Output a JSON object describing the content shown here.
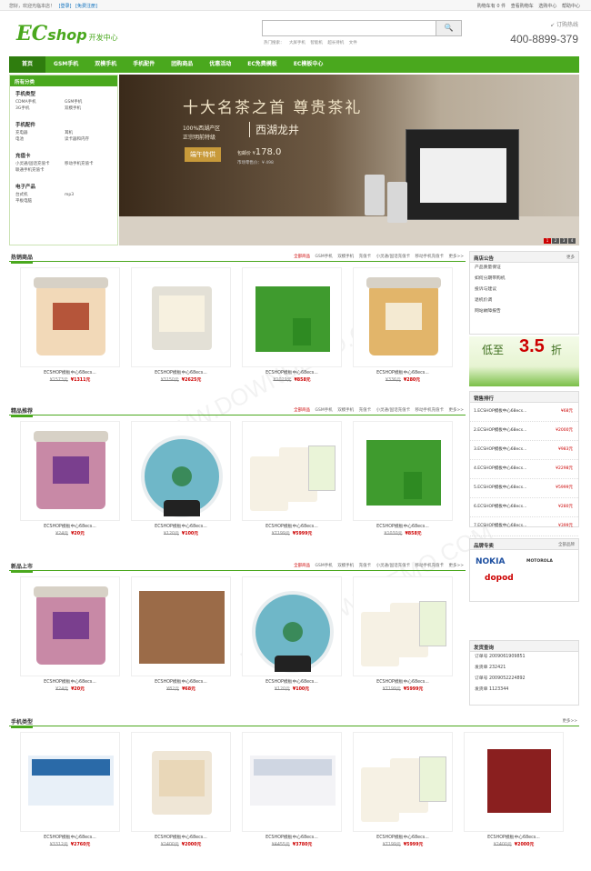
{
  "topbar": {
    "left": [
      "您好，欢迎光临本店！",
      "[登录]",
      "[免费注册]"
    ],
    "right": [
      "购物车有 0 件",
      "查看购物车",
      "选购中心",
      "帮助中心"
    ]
  },
  "logo": {
    "letter": "EC",
    "word": "shop",
    "tagline": "开发中心"
  },
  "search": {
    "placeholder": "",
    "button": "🔍",
    "hot_label": "热门搜索：",
    "hot": [
      "大屏手机",
      "智能机",
      "超长待机",
      "文件"
    ]
  },
  "hotline": {
    "label": "↙ 订购热线",
    "phone": "400-8899-379"
  },
  "nav": [
    "首页",
    "GSM手机",
    "双模手机",
    "手机配件",
    "团购商品",
    "优惠活动",
    "EC免费模板",
    "EC模板中心"
  ],
  "categories": {
    "title": "所有分类",
    "groups": [
      {
        "title": "手机类型",
        "items": [
          "CDMA手机",
          "GSM手机",
          "3G手机",
          "双模手机"
        ]
      },
      {
        "title": "手机配件",
        "items": [
          "充电器",
          "耳机",
          "电池",
          "读卡器和内存"
        ]
      },
      {
        "title": "充值卡",
        "items": [
          "小灵通/固话充值卡",
          "移动手机充值卡",
          "联通手机充值卡"
        ]
      },
      {
        "title": "电子产品",
        "items": [
          "台式机",
          "mp3",
          "平板电脑"
        ]
      }
    ]
  },
  "banner": {
    "headline": "十大名茶之首 尊贵茶礼",
    "line1": "100%西湖产区",
    "line2": "正宗明前特级",
    "product": "西湖龙井",
    "tag": "端午特供",
    "price_label": "包邮价 ¥",
    "price": "178.0",
    "market": "市场零售价：¥ 498",
    "dots": [
      "1",
      "2",
      "3",
      "4"
    ]
  },
  "sections": [
    {
      "title": "热销商品",
      "tabs": [
        "全部商品",
        "GSM手机",
        "双模手机",
        "充值卡",
        "小灵通/固话充值卡",
        "移动手机充值卡",
        "更多>>"
      ],
      "products": [
        {
          "name": "ECSHOP模板中心68ecs...",
          "old": "¥1573元",
          "price": "¥1311元"
        },
        {
          "name": "ECSHOP模板中心68ecs...",
          "old": "¥3150元",
          "price": "¥2625元"
        },
        {
          "name": "ECSHOP模板中心68ecs...",
          "old": "¥1029元",
          "price": "¥858元"
        },
        {
          "name": "ECSHOP模板中心68ecs...",
          "old": "¥336元",
          "price": "¥280元"
        }
      ]
    },
    {
      "title": "精品推荐",
      "tabs": [
        "全部商品",
        "GSM手机",
        "双模手机",
        "充值卡",
        "小灵通/固话充值卡",
        "移动手机充值卡",
        "更多>>"
      ],
      "products": [
        {
          "name": "ECSHOP模板中心68ecs...",
          "old": "¥24元",
          "price": "¥20元"
        },
        {
          "name": "ECSHOP模板中心68ecs...",
          "old": "¥120元",
          "price": "¥100元"
        },
        {
          "name": "ECSHOP模板中心68ecs...",
          "old": "¥7199元",
          "price": "¥5999元"
        },
        {
          "name": "ECSHOP模板中心68ecs...",
          "old": "¥1030元",
          "price": "¥858元"
        }
      ]
    },
    {
      "title": "新品上市",
      "tabs": [
        "全部商品",
        "GSM手机",
        "双模手机",
        "充值卡",
        "小灵通/固话充值卡",
        "移动手机充值卡",
        "更多>>"
      ],
      "products": [
        {
          "name": "ECSHOP模板中心68ecs...",
          "old": "¥24元",
          "price": "¥20元"
        },
        {
          "name": "ECSHOP模板中心68ecs...",
          "old": "¥82元",
          "price": "¥68元"
        },
        {
          "name": "ECSHOP模板中心68ecs...",
          "old": "¥120元",
          "price": "¥100元"
        },
        {
          "name": "ECSHOP模板中心68ecs...",
          "old": "¥7199元",
          "price": "¥5999元"
        }
      ]
    },
    {
      "title": "手机类型",
      "tabs": [
        "更多>>"
      ],
      "products": [
        {
          "name": "ECSHOP模板中心68ecs...",
          "old": "¥3312元",
          "price": "¥2760元"
        },
        {
          "name": "ECSHOP模板中心68ecs...",
          "old": "¥2400元",
          "price": "¥2000元"
        },
        {
          "name": "ECSHOP模板中心68ecs...",
          "old": "¥4455元",
          "price": "¥3780元"
        },
        {
          "name": "ECSHOP模板中心68ecs...",
          "old": "¥7199元",
          "price": "¥5999元"
        },
        {
          "name": "ECSHOP模板中心68ecs...",
          "old": "¥2400元",
          "price": "¥2000元"
        }
      ]
    }
  ],
  "notice": {
    "title": "商店公告",
    "more": "更多",
    "items": [
      "产品质量保证",
      "如何分期带购机",
      "投诉与建议",
      "退机价调",
      "网站故障报告"
    ]
  },
  "promo": {
    "prefix": "低至",
    "num": "3.5",
    "suffix": "折"
  },
  "ranking": {
    "title": "销售排行",
    "items": [
      {
        "label": "1.ECSHOP模板中心68ecs...",
        "price": "¥68元"
      },
      {
        "label": "2.ECSHOP模板中心68ecs...",
        "price": "¥2000元"
      },
      {
        "label": "3.ECSHOP模板中心68ecs...",
        "price": "¥983元"
      },
      {
        "label": "4.ECSHOP模板中心68ecs...",
        "price": "¥2298元"
      },
      {
        "label": "5.ECSHOP模板中心68ecs...",
        "price": "¥5999元"
      },
      {
        "label": "6.ECSHOP模板中心68ecs...",
        "price": "¥280元"
      },
      {
        "label": "7.ECSHOP模板中心68ecs...",
        "price": "¥399元"
      }
    ]
  },
  "brands": {
    "title": "品牌专卖",
    "more": "全部品牌",
    "items": [
      "NOKIA",
      "MOTOROLA",
      "dopod"
    ]
  },
  "invoice": {
    "title": "发货查询",
    "items": [
      {
        "k": "订单号",
        "v": "2009061909851"
      },
      {
        "k": "发货单",
        "v": "232421"
      },
      {
        "k": "订单号",
        "v": "2009052224892"
      },
      {
        "k": "发货单",
        "v": "1123344"
      }
    ]
  },
  "watermark": "WWW.DOWNDEMO.COM",
  "colors": {
    "accent": "#4aa81e",
    "price": "#cc0000"
  }
}
